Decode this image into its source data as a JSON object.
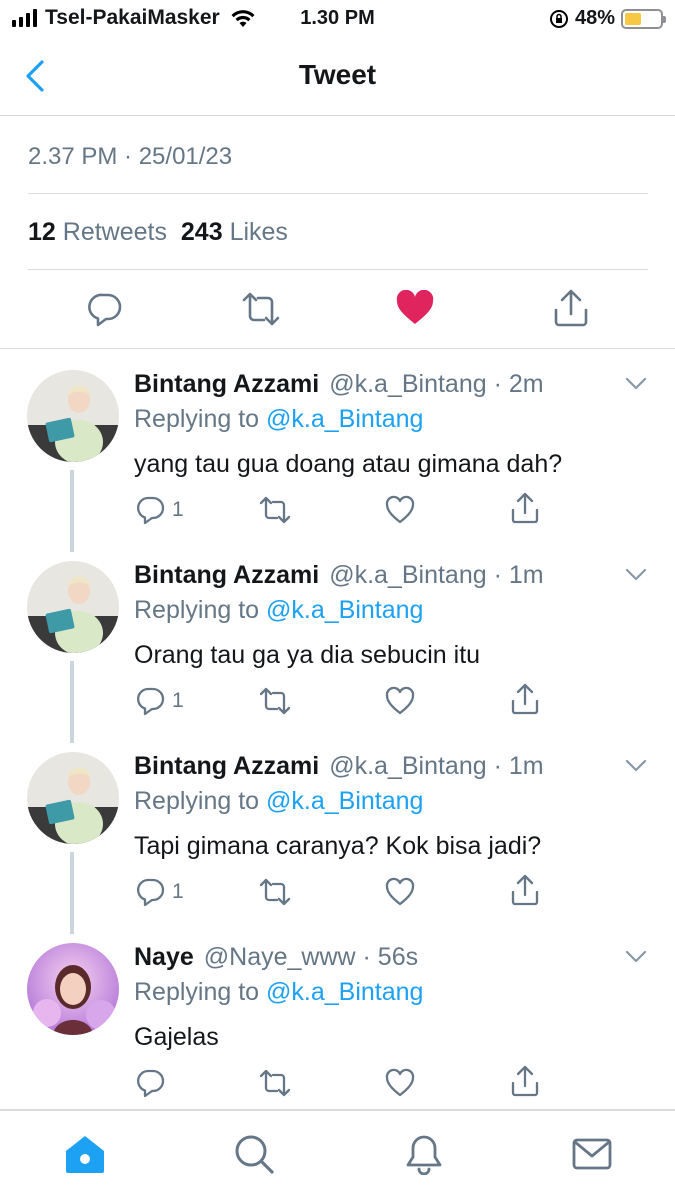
{
  "status_bar": {
    "carrier": "Tsel-PakaiMasker",
    "time": "1.30 PM",
    "battery": "48%",
    "battery_level": 0.48,
    "battery_color": "#f7c844"
  },
  "nav": {
    "title": "Tweet",
    "back_icon": "chevron-left-icon"
  },
  "tweet": {
    "timestamp": "2.37 PM · 25/01/23",
    "retweets_count": "12",
    "retweets_label": "Retweets",
    "likes_count": "243",
    "likes_label": "Likes",
    "like_color": "#e0245e"
  },
  "replies": [
    {
      "name": "Bintang Azzami",
      "handle": "@k.a_Bintang · 2m",
      "replying_prefix": "Replying to",
      "replying_to": "@k.a_Bintang",
      "text": "yang tau gua doang atau gimana dah?",
      "reply_count": "1"
    },
    {
      "name": "Bintang Azzami",
      "handle": "@k.a_Bintang · 1m",
      "replying_prefix": "Replying to",
      "replying_to": "@k.a_Bintang",
      "text": "Orang tau ga ya dia sebucin itu",
      "reply_count": "1"
    },
    {
      "name": "Bintang Azzami",
      "handle": "@k.a_Bintang · 1m",
      "replying_prefix": "Replying to",
      "replying_to": "@k.a_Bintang",
      "text": "Tapi gimana caranya? Kok bisa jadi?",
      "reply_count": "1"
    },
    {
      "name": "Naye",
      "handle": "@Naye_www · 56s",
      "replying_prefix": "Replying to",
      "replying_to": "@k.a_Bintang",
      "text": "Gajelas",
      "reply_count": ""
    }
  ],
  "tabbar": {
    "items": [
      "home-icon",
      "search-icon",
      "bell-icon",
      "mail-icon"
    ],
    "active_color": "#1da1f2"
  }
}
